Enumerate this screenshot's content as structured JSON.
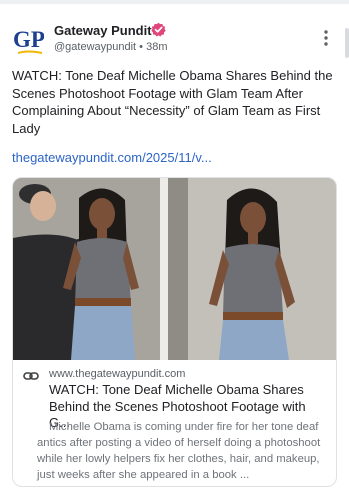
{
  "post": {
    "author_name": "Gateway Pundit",
    "author_handle": "@gatewaypundit",
    "separator": "•",
    "timestamp": "38m",
    "avatar_text": "GP",
    "text": "WATCH: Tone Deaf Michelle Obama Shares Behind the Scenes Photoshoot Footage with Glam Team After Complaining About “Necessity” of Glam Team as First Lady",
    "link": "thegatewaypundit.com/2025/11/v..."
  },
  "card": {
    "domain": "www.thegatewaypundit.com",
    "title": "WATCH: Tone Deaf Michelle Obama Shares Behind the Scenes Photoshoot Footage with G...",
    "description": "Michelle Obama is coming under fire for her tone deaf antics after posting a video of herself doing a photoshoot while her lowly helpers fix her clothes, hair, and makeup, just weeks after she appeared in a book ..."
  },
  "colors": {
    "link": "#2d64c8",
    "verified": "#e0457b",
    "brand_blue": "#1d3f8f",
    "brand_yellow": "#f2b705"
  },
  "icons": [
    "gp-logo-avatar",
    "verified-badge-icon",
    "more-vertical-icon",
    "link-icon"
  ]
}
